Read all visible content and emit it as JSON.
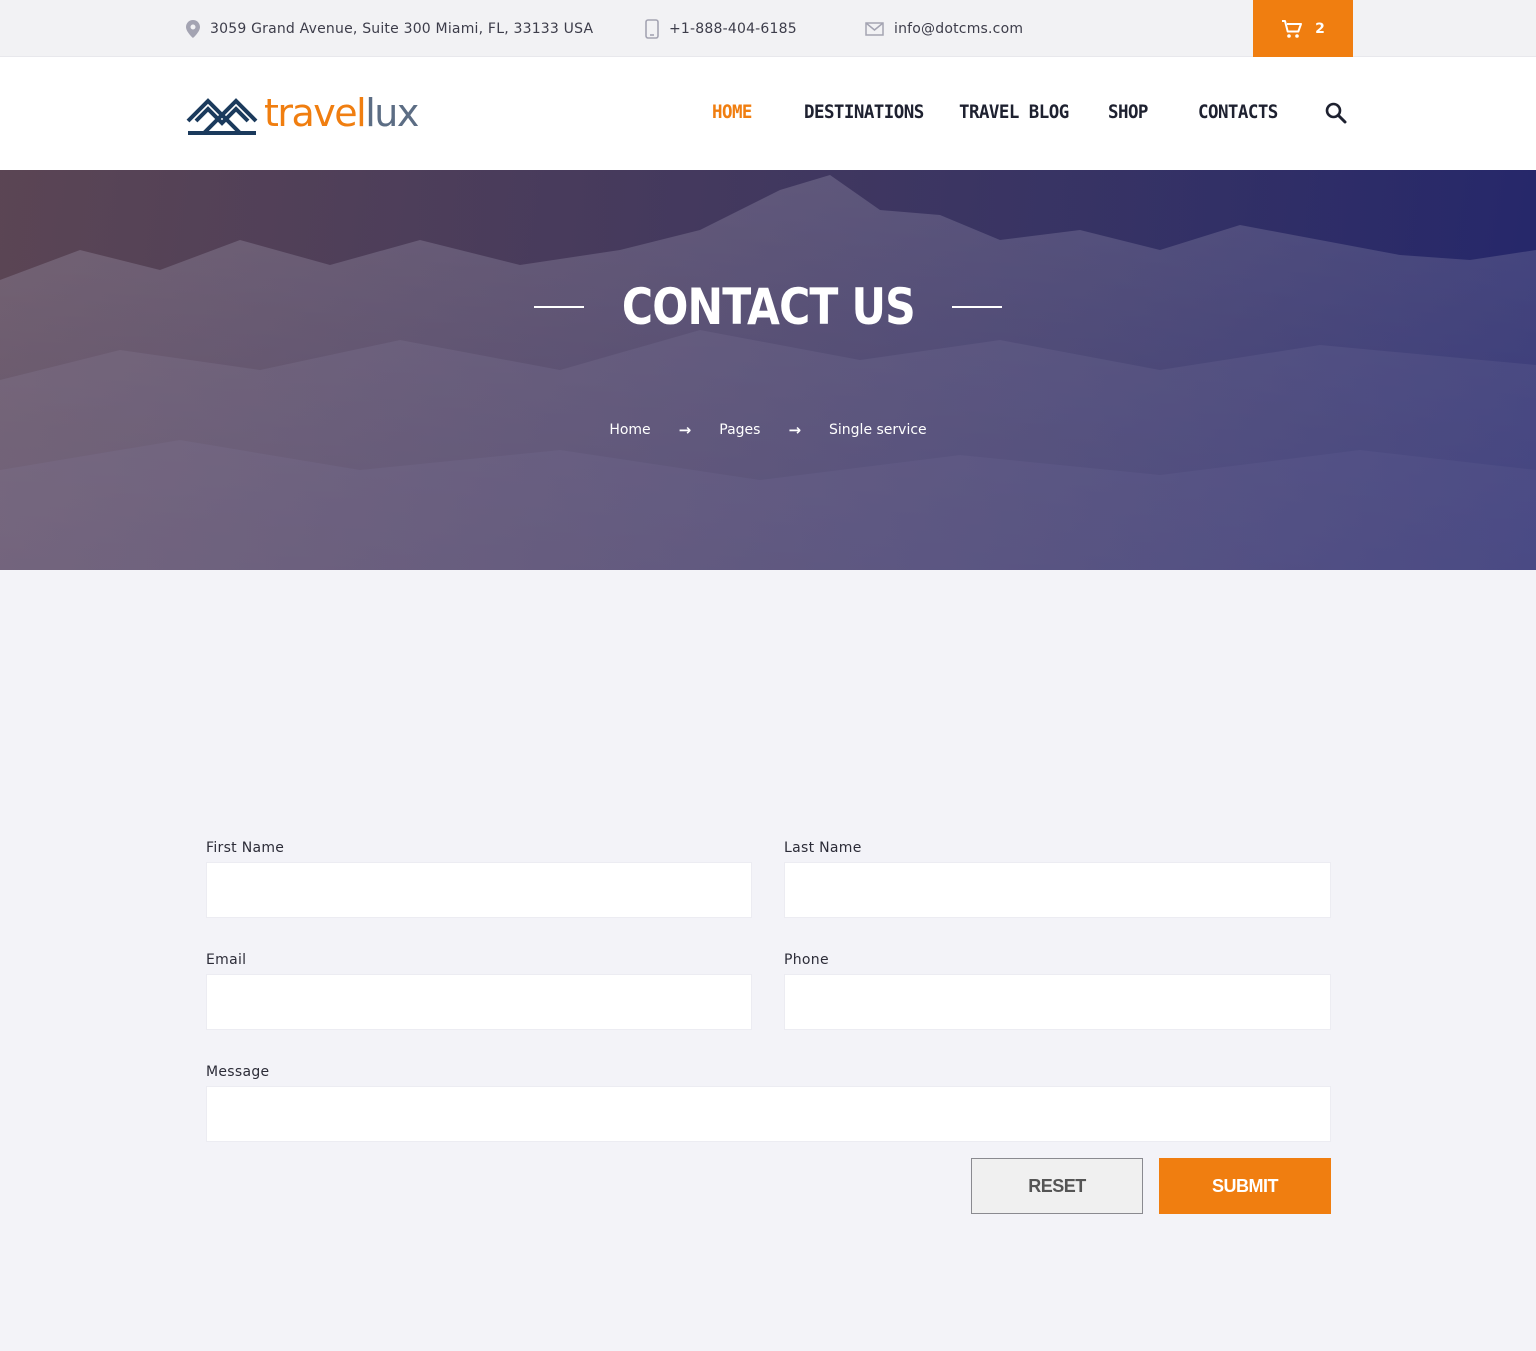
{
  "topbar": {
    "address": "3059 Grand Avenue, Suite 300 Miami, FL, 33133 USA",
    "phone": "+1-888-404-6185",
    "email": "info@dotcms.com",
    "cart_count": "2",
    "icons": [
      "location-pin-icon",
      "phone-icon",
      "mail-icon",
      "cart-icon"
    ]
  },
  "header": {
    "logo": {
      "part1": "travel",
      "part2": "lux"
    },
    "nav": [
      {
        "label": "HOME",
        "active": true
      },
      {
        "label": "DESTINATIONS",
        "active": false
      },
      {
        "label": "TRAVEL BLOG",
        "active": false
      },
      {
        "label": "SHOP",
        "active": false
      },
      {
        "label": "CONTACTS",
        "active": false
      }
    ]
  },
  "hero": {
    "title": "CONTACT US",
    "breadcrumb": [
      "Home",
      "Pages",
      "Single service"
    ]
  },
  "form": {
    "first_name_label": "First Name",
    "last_name_label": "Last Name",
    "email_label": "Email",
    "phone_label": "Phone",
    "message_label": "Message",
    "reset_label": "RESET",
    "submit_label": "SUBMIT"
  },
  "colors": {
    "accent": "#f07e10",
    "logo_blue": "#1b3a5c",
    "logo_grey": "#5c6d84",
    "nav_text": "#1e2130",
    "page_bg": "#f3f3f8"
  }
}
